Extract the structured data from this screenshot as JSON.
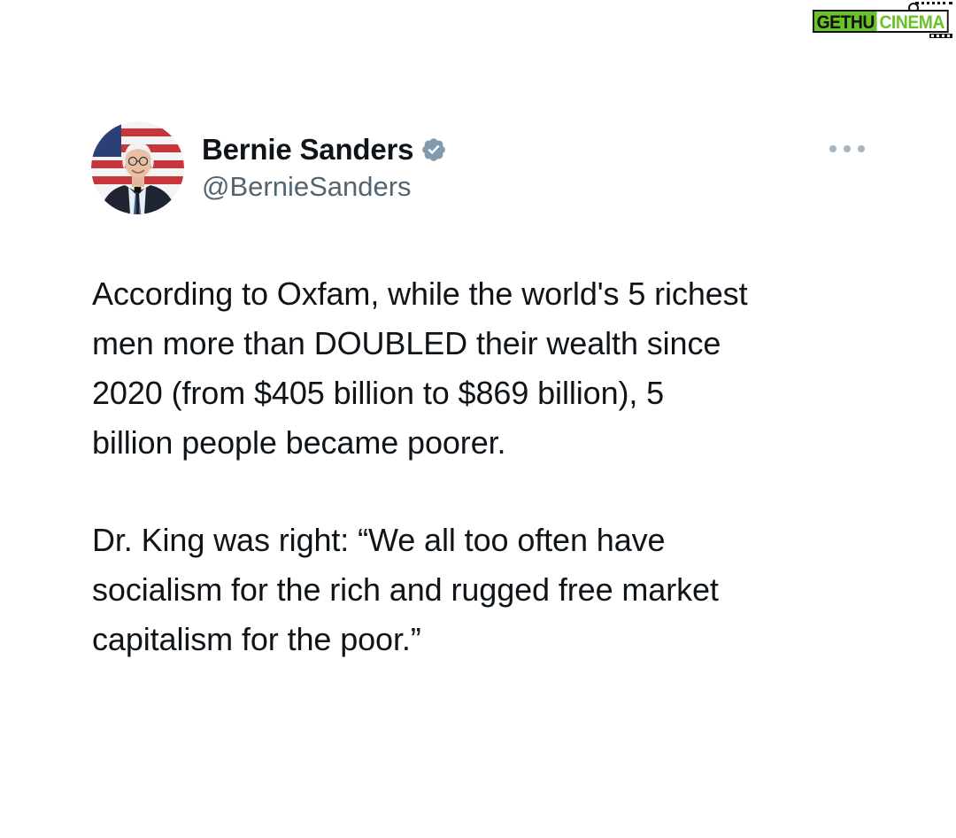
{
  "watermark": {
    "part1": "GETHU",
    "part2": "CINEMA"
  },
  "tweet": {
    "author": {
      "display_name": "Bernie Sanders",
      "handle": "@BernieSanders",
      "verified": true,
      "avatar_icon": "avatar-photo"
    },
    "more_icon": "more-horizontal-icon",
    "paragraphs": [
      "According to Oxfam, while the world's 5 richest\nmen more than DOUBLED their wealth since\n2020 (from $405 billion to $869 billion), 5\nbillion people became poorer.",
      "Dr. King was right: “We all too often have\nsocialism for the rich and rugged free market\ncapitalism for the poor.”"
    ]
  },
  "colors": {
    "text_primary": "#0f1419",
    "text_secondary": "#536471",
    "verified_badge": "#829aab",
    "watermark_green": "#6ac229"
  }
}
